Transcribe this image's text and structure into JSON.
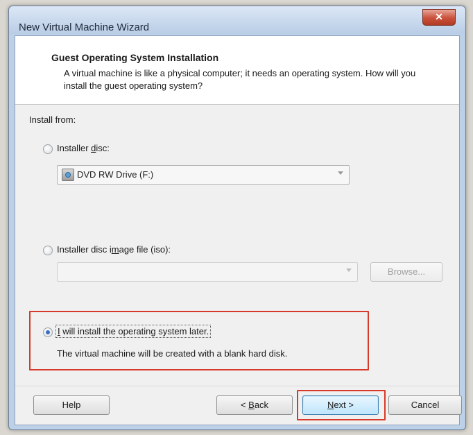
{
  "window": {
    "title": "New Virtual Machine Wizard",
    "close_glyph": "✕"
  },
  "header": {
    "title": "Guest Operating System Installation",
    "description": "A virtual machine is like a physical computer; it needs an operating system. How will you install the guest operating system?"
  },
  "install_from_label": "Install from:",
  "options": {
    "installer_disc": {
      "label": "Installer disc:",
      "selected": false
    },
    "disc_drive": {
      "value": "DVD RW Drive (F:)"
    },
    "iso": {
      "label": "Installer disc image file (iso):",
      "selected": false,
      "value": ""
    },
    "browse_label": "Browse...",
    "later": {
      "label": "I will install the operating system later.",
      "selected": true
    },
    "later_note": "The virtual machine will be created with a blank hard disk."
  },
  "buttons": {
    "help": "Help",
    "back": "< Back",
    "next": "Next >",
    "cancel": "Cancel"
  },
  "colors": {
    "highlight": "#d63a2a",
    "accent": "#3a6fc0"
  }
}
